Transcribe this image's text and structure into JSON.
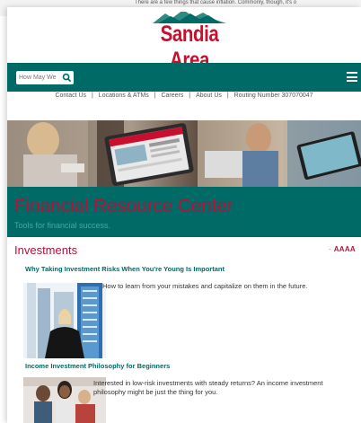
{
  "background_page": {
    "snippet": "There are a few things that cause inflation. Commonly, though, it's o"
  },
  "brand": {
    "name": "Sandia Area",
    "colors": {
      "red": "#c8102e",
      "teal": "#006a66"
    }
  },
  "header": {
    "search_placeholder": "How May We",
    "search_icon": "search-icon",
    "menu_icon": "hamburger-menu-icon"
  },
  "utility_nav": {
    "items": [
      "Contact Us",
      "Locations & ATMs",
      "Careers",
      "About Us",
      "Routing Number 307070047"
    ],
    "separator": "|"
  },
  "hero": {
    "title": "Financial Resource Center",
    "subtitle": "Tools for financial success."
  },
  "section": {
    "title": "Investments",
    "text_size_dash": "-",
    "text_size_label": "AAAA"
  },
  "articles": [
    {
      "title": "Why Taking Investment Risks When You're Young Is Important",
      "description": "How to learn from your mistakes and capitalize on them in the future."
    },
    {
      "title": "Income Investment Philosophy for Beginners",
      "description": "Interested in low-risk investments with steady returns? An income investment philosophy might be just the thing for you."
    }
  ]
}
